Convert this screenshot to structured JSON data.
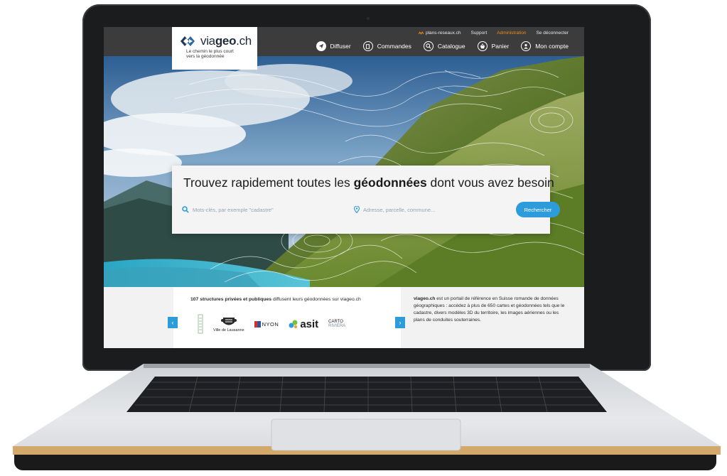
{
  "logo": {
    "text_regular": "via",
    "text_bold": "geo",
    "text_suffix": ".ch",
    "tagline": "Le chemin le plus court vers la géodonnée"
  },
  "utility_nav": {
    "plans_reseaux": "plans-reseaux.ch",
    "support": "Support",
    "administration": "Administration",
    "logout": "Se déconnecter"
  },
  "main_nav": [
    {
      "label": "Diffuser",
      "icon": "send-icon"
    },
    {
      "label": "Commandes",
      "icon": "orders-icon"
    },
    {
      "label": "Catalogue",
      "icon": "search-icon"
    },
    {
      "label": "Panier",
      "icon": "basket-icon"
    },
    {
      "label": "Mon compte",
      "icon": "user-icon"
    }
  ],
  "hero": {
    "title_pre": "Trouvez rapidement toutes les ",
    "title_bold": "géodonnées",
    "title_post": " dont vous avez besoin",
    "keyword_placeholder": "Mots-clés, par exemple \"cadastre\"",
    "address_placeholder": "Adresse, parcelle, commune...",
    "search_button": "Rechercher"
  },
  "partners": {
    "title_bold": "107 structures privées et publiques",
    "title_rest": " diffusent leurs géodonnées sur viageo.ch",
    "logos": [
      {
        "name": "partner-logo-vertical",
        "label": ""
      },
      {
        "name": "ville-de-lausanne-logo",
        "label": "Ville de Lausanne"
      },
      {
        "name": "nyon-logo",
        "label": "NYON"
      },
      {
        "name": "asit-logo",
        "label": "asit"
      },
      {
        "name": "carto-riviera-logo",
        "label_top": "CARTO",
        "label_bottom": "RIVIERA"
      }
    ]
  },
  "about": {
    "lead": "viageo.ch",
    "text": " est un portail de référence en Suisse romande de données géographiques : accédez à plus de 650 cartes et géodonnées tels que le cadastre, divers modèles 3D du territoire, les images aériennes ou les plans de conduites souterraines."
  },
  "colors": {
    "accent": "#2d9cdb",
    "admin": "#f08c1e",
    "topbar": "#3c3c3c"
  }
}
